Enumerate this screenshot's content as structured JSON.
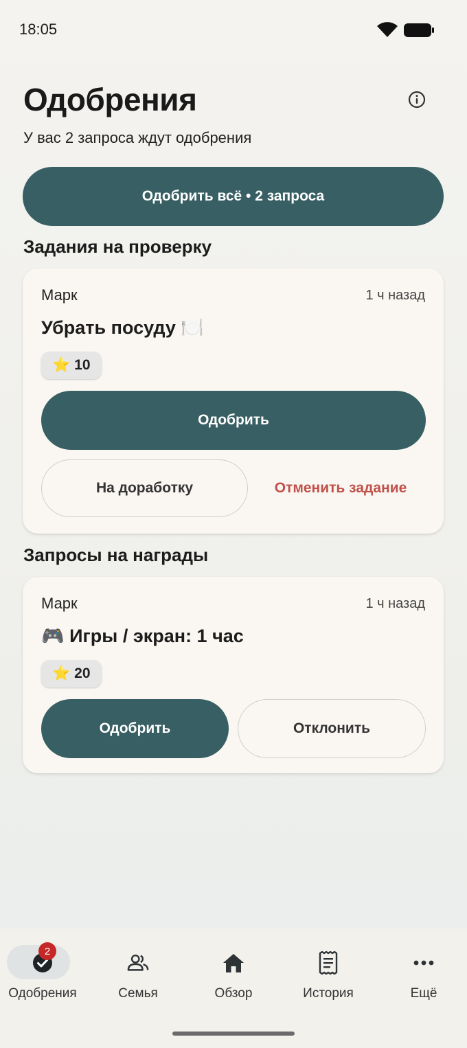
{
  "status_bar": {
    "time": "18:05",
    "wifi_icon": "wifi-icon",
    "battery_icon": "battery-icon"
  },
  "header": {
    "title": "Одобрения",
    "subtitle": "У вас 2 запроса ждут одобрения",
    "info_icon": "info-icon"
  },
  "approve_all": {
    "label": "Одобрить всё • 2 запроса"
  },
  "tasks_section": {
    "title": "Задания на проверку",
    "card": {
      "user": "Марк",
      "time": "1 ч назад",
      "title": "Убрать посуду 🍽️",
      "points_icon": "⭐",
      "points": "10",
      "approve_label": "Одобрить",
      "rework_label": "На доработку",
      "cancel_label": "Отменить задание"
    }
  },
  "rewards_section": {
    "title": "Запросы на награды",
    "card": {
      "user": "Марк",
      "time": "1 ч назад",
      "title": "🎮 Игры / экран: 1 час",
      "points_icon": "⭐",
      "points": "20",
      "approve_label": "Одобрить",
      "reject_label": "Отклонить"
    }
  },
  "bottom_nav": {
    "items": [
      {
        "label": "Одобрения",
        "icon": "check-circle-icon",
        "badge": "2",
        "active": true
      },
      {
        "label": "Семья",
        "icon": "group-icon"
      },
      {
        "label": "Обзор",
        "icon": "home-icon"
      },
      {
        "label": "История",
        "icon": "receipt-icon"
      },
      {
        "label": "Ещё",
        "icon": "more-horizontal-icon"
      }
    ]
  },
  "colors": {
    "primary": "#385f63",
    "danger": "#c1504a",
    "badge": "#c62828",
    "card": "#faf7f2"
  }
}
